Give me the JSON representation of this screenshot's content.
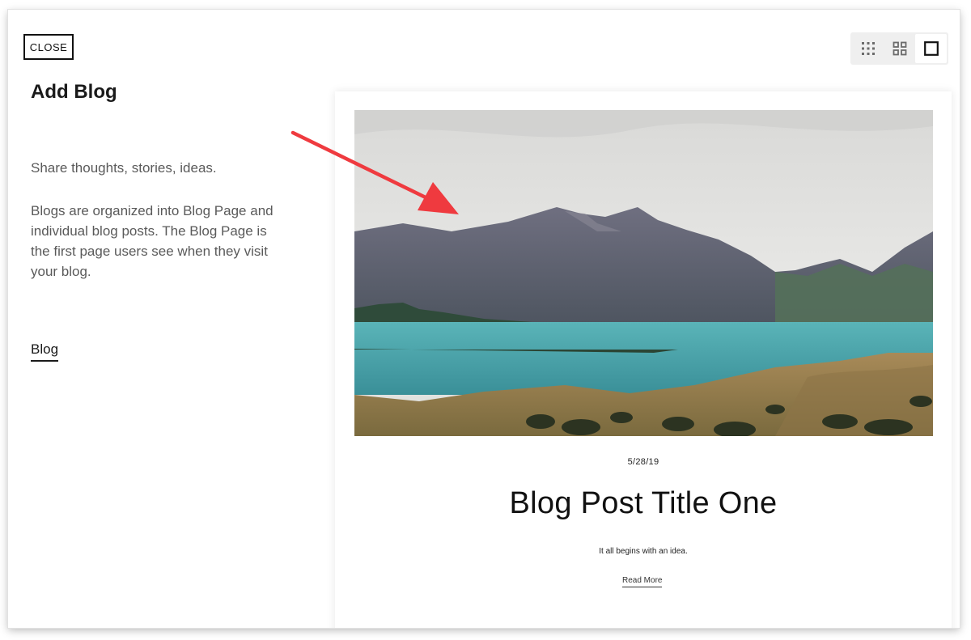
{
  "close_label": "CLOSE",
  "sidebar": {
    "heading": "Add Blog",
    "tagline": "Share thoughts, stories, ideas.",
    "description": "Blogs are organized into Blog Page and individual blog posts. The Blog Page is the first page users see when they visit your blog.",
    "link_label": "Blog"
  },
  "layout_options": [
    {
      "icon": "grid-3x3-icon",
      "selected": false
    },
    {
      "icon": "grid-2x2-icon",
      "selected": false
    },
    {
      "icon": "single-square-icon",
      "selected": true
    }
  ],
  "preview": {
    "date": "5/28/19",
    "title": "Blog Post Title One",
    "excerpt": "It all begins with an idea.",
    "read_more": "Read More"
  },
  "colors": {
    "annotation_arrow": "#ef3a3f",
    "lake": "#3f9ea6",
    "sky": "#dcdcda"
  }
}
